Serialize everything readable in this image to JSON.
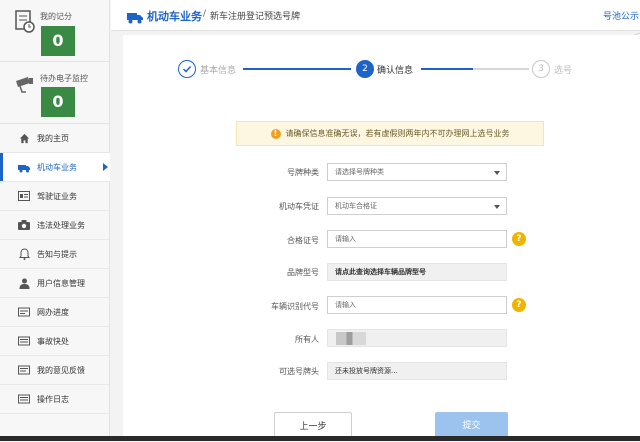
{
  "sidebar": {
    "score_label": "我的记分",
    "score_value": "0",
    "monitor_label": "待办电子监控",
    "monitor_value": "0",
    "items": [
      {
        "label": "我的主页",
        "icon": "home-icon"
      },
      {
        "label": "机动车业务",
        "icon": "car-icon",
        "active": true
      },
      {
        "label": "驾驶证业务",
        "icon": "license-icon"
      },
      {
        "label": "违法处理业务",
        "icon": "camera-icon"
      },
      {
        "label": "告知与提示",
        "icon": "bell-icon"
      },
      {
        "label": "用户信息管理",
        "icon": "user-icon"
      },
      {
        "label": "网办进度",
        "icon": "progress-icon"
      },
      {
        "label": "事故快处",
        "icon": "accident-icon"
      },
      {
        "label": "我的意见反馈",
        "icon": "feedback-icon"
      },
      {
        "label": "操作日志",
        "icon": "log-icon"
      }
    ]
  },
  "header": {
    "section": "机动车业务",
    "separator": "/",
    "page": "新车注册登记预选号牌",
    "right_link": "号池公示"
  },
  "steps": [
    {
      "label": "基本信息",
      "state": "done"
    },
    {
      "number": "2",
      "label": "确认信息",
      "state": "current"
    },
    {
      "number": "3",
      "label": "选号",
      "state": "pending"
    }
  ],
  "notice": "请确保信息准确无误，若有虚假则两年内不可办理网上选号业务",
  "form": {
    "plate_type": {
      "label": "号牌种类",
      "value": "请选择号牌种类"
    },
    "vehicle_cert": {
      "label": "机动车凭证",
      "value": "机动车合格证"
    },
    "cert_no": {
      "label": "合格证号",
      "placeholder": "请输入"
    },
    "brand_model": {
      "label": "品牌型号",
      "value": "请点此查询选择车辆品牌型号"
    },
    "vin": {
      "label": "车辆识别代号",
      "placeholder": "请输入"
    },
    "owner": {
      "label": "所有人"
    },
    "plate_prefix": {
      "label": "可选号牌头",
      "value": "还未投放号牌资源..."
    }
  },
  "help_glyph": "?",
  "buttons": {
    "prev": "上一步",
    "submit": "提交"
  },
  "colors": {
    "accent": "#1e64c8",
    "score_green": "#3a8a46",
    "submit_disabled": "#9bc3ee"
  }
}
